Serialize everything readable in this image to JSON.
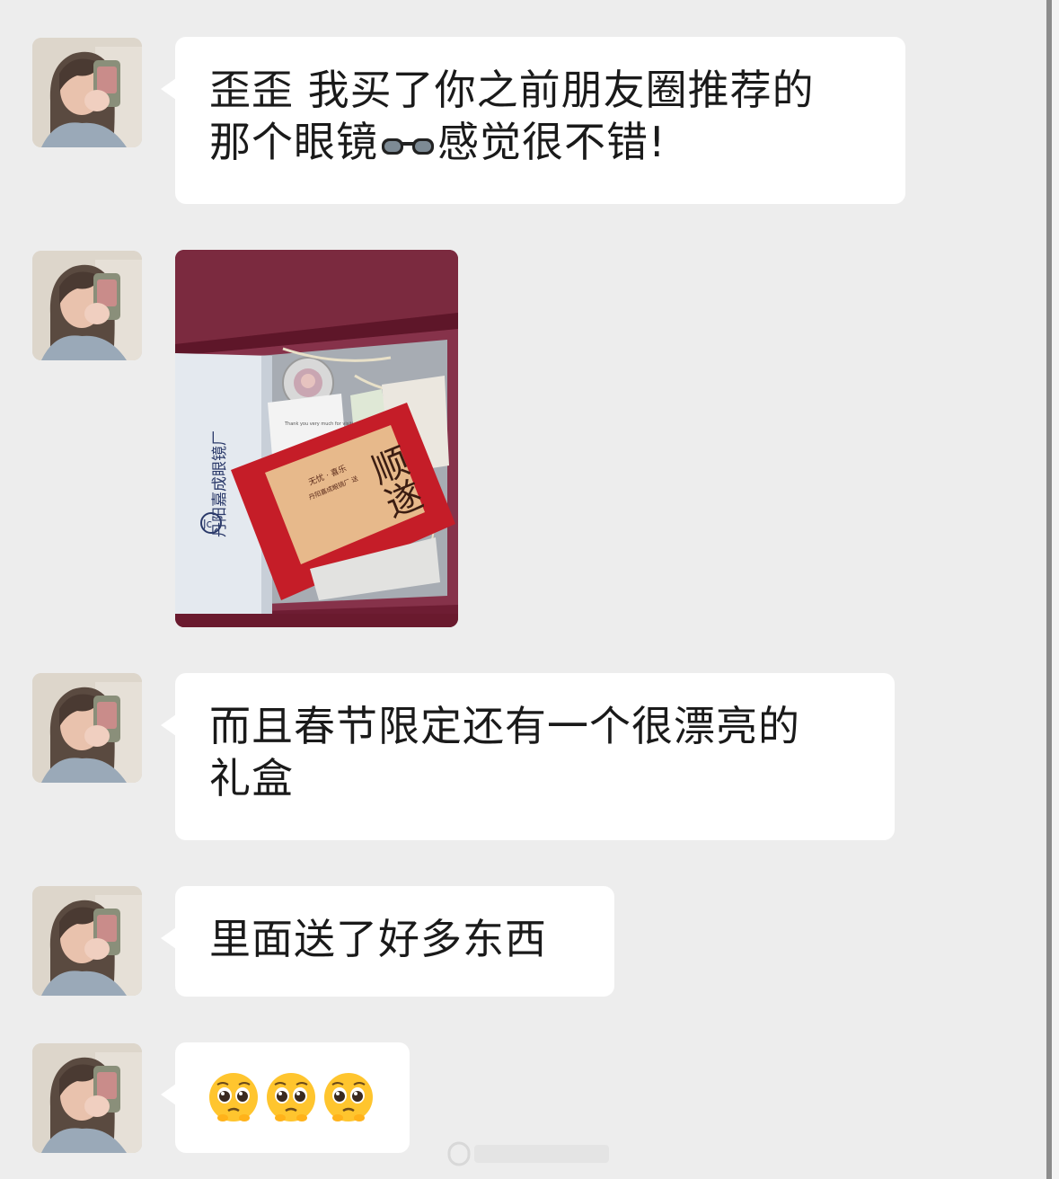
{
  "chat": {
    "messages": [
      {
        "type": "text",
        "text_line1": "歪歪 我买了你之前朋友圈推荐的",
        "text_line2": "感觉很不错!",
        "text_line2_prefix": "那个眼镜",
        "emoji": "sunglasses-icon"
      },
      {
        "type": "image",
        "image_text": {
          "box_brand": "丹阳嘉成眼镜厂",
          "logo": "Jc",
          "card_title": "顺遂",
          "card_sub": "无忧 · 喜乐",
          "card_sub2": "丹阳嘉成眼镜厂 送",
          "thank": "Thank you very much for visiting"
        }
      },
      {
        "type": "text",
        "text_line1": "而且春节限定还有一个很漂亮的",
        "text_line2": "礼盒"
      },
      {
        "type": "text",
        "text_line1": "里面送了好多东西"
      },
      {
        "type": "emoji",
        "emojis": [
          "pleading-face-icon",
          "pleading-face-icon",
          "pleading-face-icon"
        ]
      }
    ]
  },
  "colors": {
    "background": "#ededed",
    "bubble": "#ffffff",
    "text": "#1a1a1a",
    "box_lid": "#7a2237",
    "card_red": "#c51d28"
  }
}
